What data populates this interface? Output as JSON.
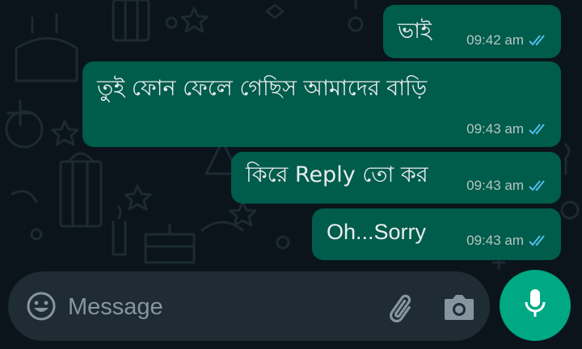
{
  "messages": [
    {
      "text": "ভাই",
      "time": "09:42 am",
      "status": "read"
    },
    {
      "text": "তুই ফোন ফেলে গেছিস আমাদের বাড়ি",
      "time": "09:43 am",
      "status": "read"
    },
    {
      "text": "কিরে Reply তো কর",
      "time": "09:43 am",
      "status": "read"
    },
    {
      "text": "Oh...Sorry",
      "time": "09:43 am",
      "status": "read"
    }
  ],
  "composer": {
    "placeholder": "Message",
    "emoji_icon": "emoji-icon",
    "attach_icon": "paperclip-icon",
    "camera_icon": "camera-icon",
    "mic_icon": "microphone-icon"
  },
  "colors": {
    "background": "#0b141a",
    "outgoing_bubble": "#005c4b",
    "input_bar": "#1f2c34",
    "accent": "#00a884",
    "read_ticks": "#53bdeb"
  }
}
